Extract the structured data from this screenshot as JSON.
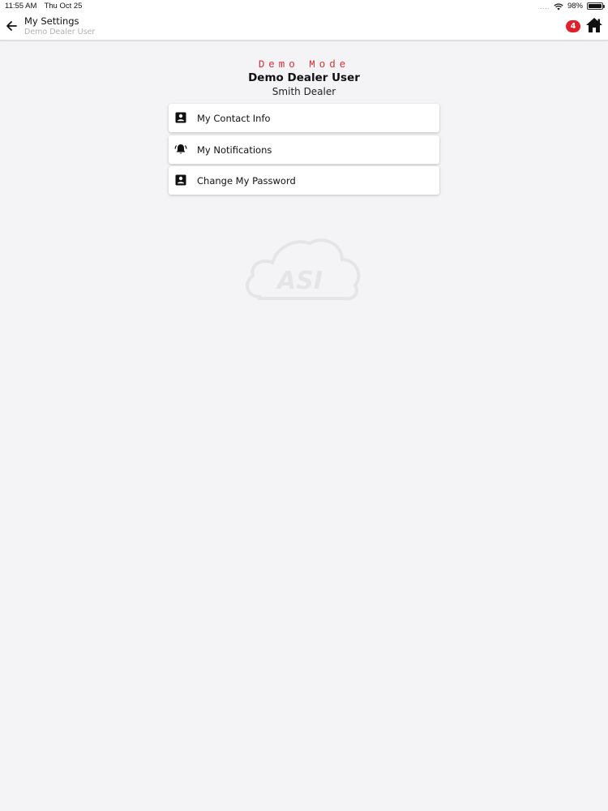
{
  "status_bar": {
    "time": "11:55 AM",
    "date": "Thu Oct 25",
    "battery": "98%",
    "battery_level": 0.98
  },
  "nav": {
    "title": "My Settings",
    "subtitle": "Demo Dealer User",
    "badge_count": "4",
    "back_icon": "arrow-left-icon",
    "home_icon": "home-icon",
    "badge_color": "#e0202a"
  },
  "header": {
    "mode": "Demo Mode",
    "user_name": "Demo Dealer User",
    "dealer_name": "Smith Dealer",
    "mode_color": "#d32f2f"
  },
  "menu": {
    "items": [
      {
        "label": "My Contact Info",
        "icon": "contact-card-icon"
      },
      {
        "label": "My Notifications",
        "icon": "bell-icon"
      },
      {
        "label": "Change My Password",
        "icon": "contact-card-icon"
      }
    ]
  },
  "watermark": {
    "text": "ASI",
    "icon": "cloud-logo-icon"
  }
}
